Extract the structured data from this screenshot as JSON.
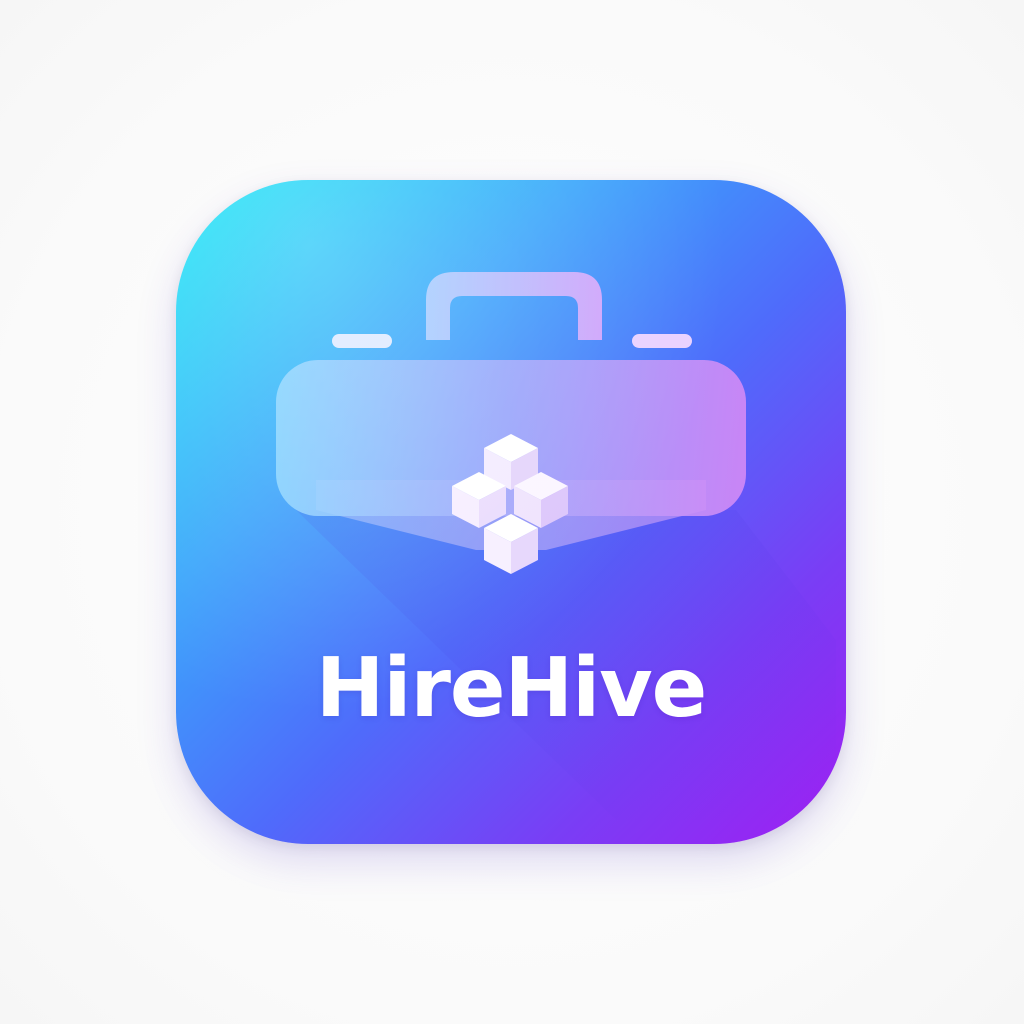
{
  "app": {
    "name": "HireHive"
  },
  "icon": {
    "symbol": "briefcase-icon",
    "emblem": "cube-cluster-icon",
    "gradient_colors": [
      "#12e9f5",
      "#3aa6fb",
      "#4f6bfb",
      "#7a3df5",
      "#a01ef2"
    ]
  }
}
